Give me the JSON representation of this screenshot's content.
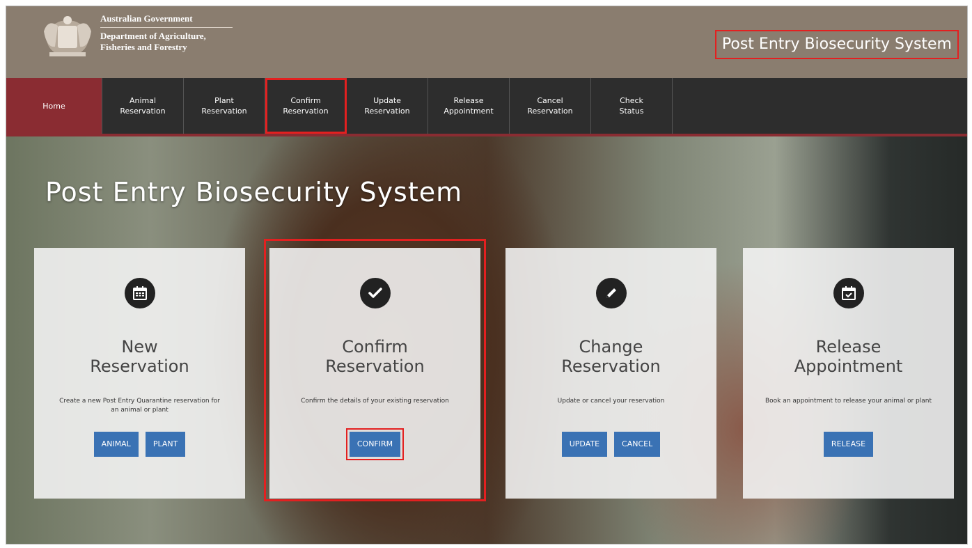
{
  "header": {
    "gov_line1": "Australian Government",
    "gov_line2": "Department of Agriculture,",
    "gov_line3": "Fisheries and Forestry",
    "system_title": "Post Entry Biosecurity System"
  },
  "nav": {
    "items": [
      {
        "label": "Home",
        "active": true
      },
      {
        "label": "Animal\nReservation"
      },
      {
        "label": "Plant\nReservation"
      },
      {
        "label": "Confirm\nReservation",
        "highlighted": true
      },
      {
        "label": "Update\nReservation"
      },
      {
        "label": "Release\nAppointment"
      },
      {
        "label": "Cancel\nReservation"
      },
      {
        "label": "Check\nStatus"
      }
    ]
  },
  "hero": {
    "title": "Post Entry Biosecurity System"
  },
  "cards": [
    {
      "icon": "calendar-grid-icon",
      "title_line1": "New",
      "title_line2": "Reservation",
      "description": "Create a new Post Entry Quarantine reservation for an animal or plant",
      "buttons": [
        "ANIMAL",
        "PLANT"
      ]
    },
    {
      "icon": "checkmark-icon",
      "title_line1": "Confirm",
      "title_line2": "Reservation",
      "description": "Confirm the details of your existing reservation",
      "buttons": [
        "CONFIRM"
      ],
      "highlighted": true
    },
    {
      "icon": "pencil-icon",
      "title_line1": "Change",
      "title_line2": "Reservation",
      "description": "Update or cancel your reservation",
      "buttons": [
        "UPDATE",
        "CANCEL"
      ]
    },
    {
      "icon": "calendar-check-icon",
      "title_line1": "Release",
      "title_line2": "Appointment",
      "description": "Book an appointment to release your animal or plant",
      "buttons": [
        "RELEASE"
      ]
    }
  ],
  "colors": {
    "header_bg": "#8a7d6f",
    "nav_bg": "#2d2d2d",
    "nav_active": "#8a2c32",
    "button_blue": "#3a72b4",
    "highlight_red": "#e32020"
  }
}
